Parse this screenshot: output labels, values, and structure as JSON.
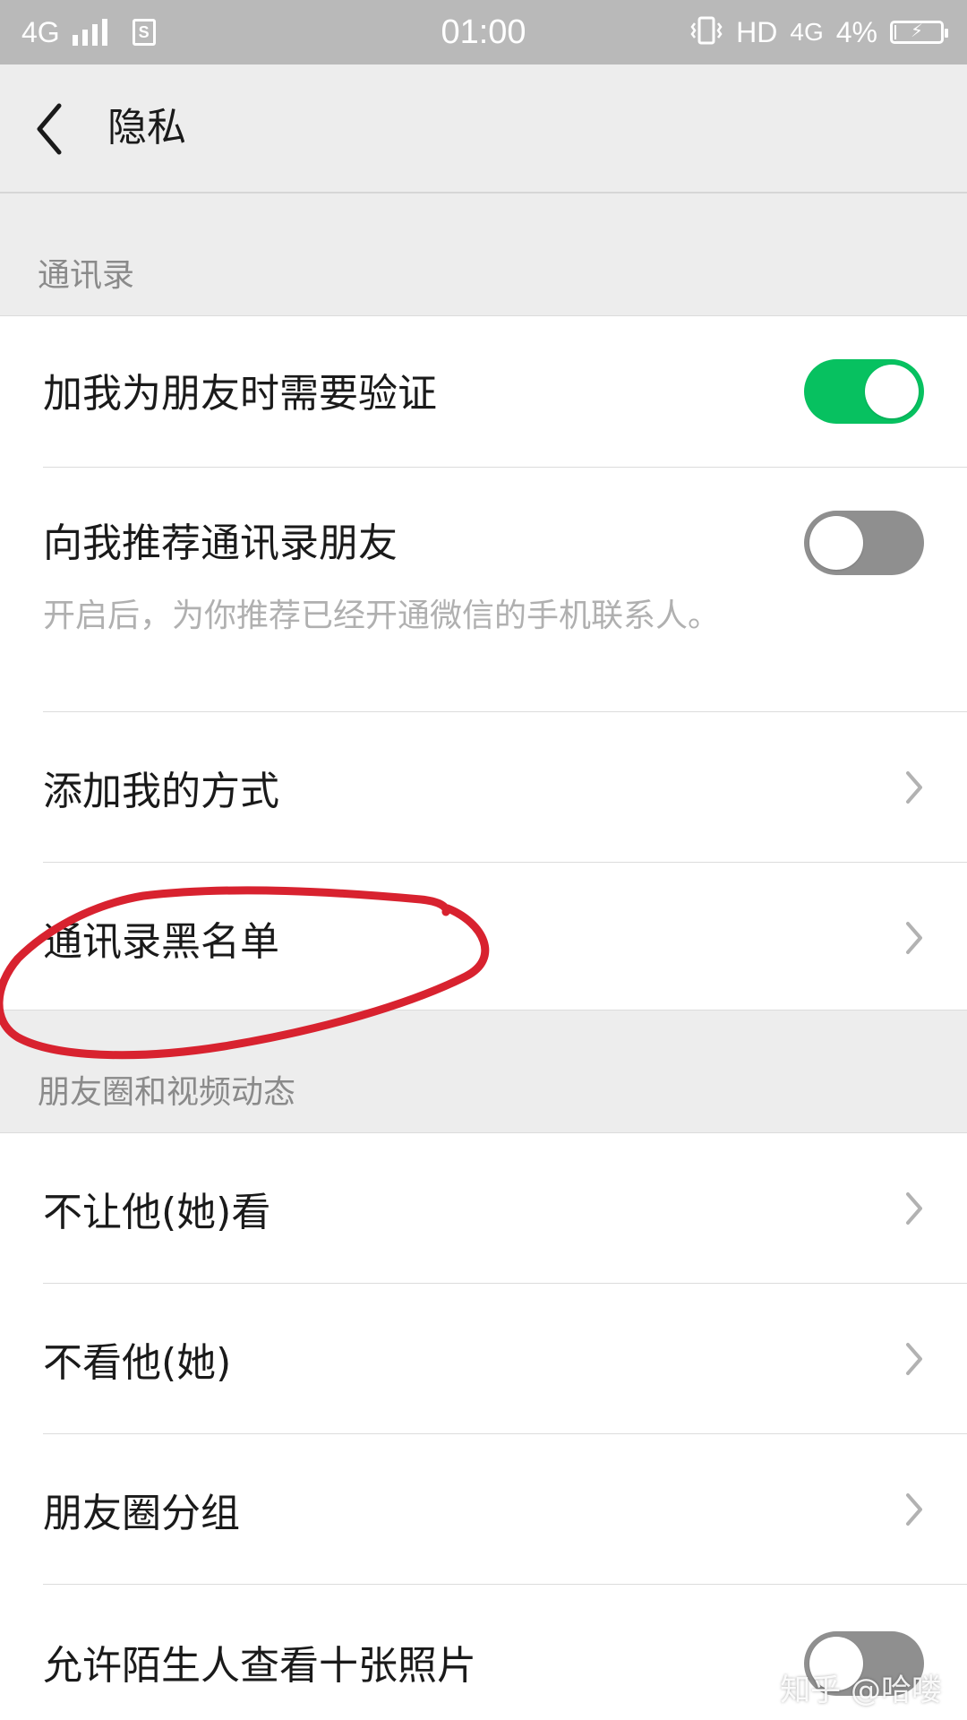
{
  "status_bar": {
    "network_left": "4G",
    "sim_icon_label": "S",
    "time": "01:00",
    "hd_label": "HD",
    "network_right": "4G",
    "battery_percent": "4%",
    "battery_level": 0.04
  },
  "nav": {
    "title": "隐私"
  },
  "sections": {
    "contacts": "通讯录",
    "moments": "朋友圈和视频动态"
  },
  "rows": {
    "verify": {
      "label": "加我为朋友时需要验证",
      "enabled": true
    },
    "recommend": {
      "label": "向我推荐通讯录朋友",
      "desc": "开启后，为你推荐已经开通微信的手机联系人。",
      "enabled": false
    },
    "add_methods": {
      "label": "添加我的方式"
    },
    "blacklist": {
      "label": "通讯录黑名单"
    },
    "hide_from": {
      "label": "不让他(她)看"
    },
    "not_see": {
      "label": "不看他(她)"
    },
    "moments_group": {
      "label": "朋友圈分组"
    },
    "stranger_photos": {
      "label": "允许陌生人查看十张照片",
      "enabled": false
    }
  },
  "colors": {
    "toggle_on": "#07c160",
    "toggle_off": "#8f8f8f",
    "annotation": "#d8222f"
  },
  "watermark": "知乎 @哈喽"
}
